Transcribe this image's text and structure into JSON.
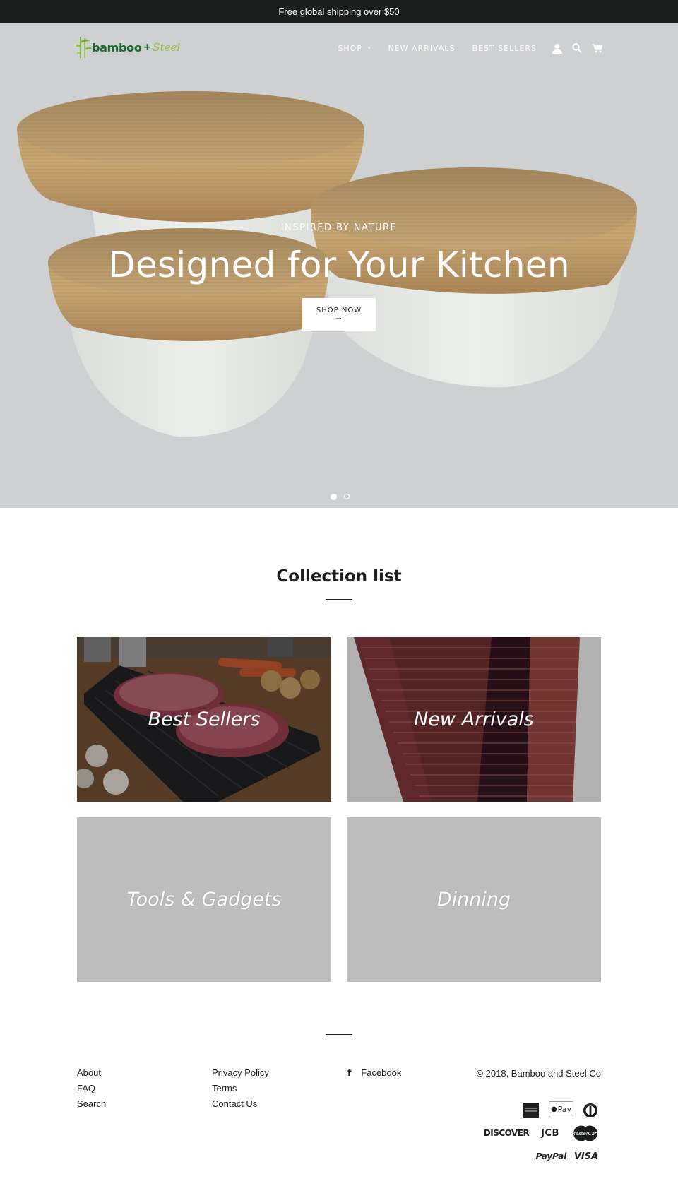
{
  "announcement": {
    "text": "Free global shipping over $50"
  },
  "header": {
    "logo": {
      "word": "bamboo",
      "plus": "+",
      "steel": "Steel"
    },
    "nav": [
      {
        "label": "SHOP",
        "has_dropdown": true
      },
      {
        "label": "NEW ARRIVALS",
        "has_dropdown": false
      },
      {
        "label": "BEST SELLERS",
        "has_dropdown": false
      }
    ],
    "icons": [
      "account-icon",
      "search-icon",
      "cart-icon"
    ],
    "dropdown_caret": "▾"
  },
  "hero": {
    "subheading": "INSPIRED BY NATURE",
    "title": "Designed for Your Kitchen",
    "button_label": "SHOP NOW",
    "button_arrow": "→",
    "slides_total": 2,
    "active_slide": 1
  },
  "collection": {
    "title": "Collection list",
    "items": [
      {
        "label": "Best Sellers"
      },
      {
        "label": "New Arrivals"
      },
      {
        "label": "Tools & Gadgets"
      },
      {
        "label": "Dinning"
      }
    ]
  },
  "footer": {
    "col1": [
      "About",
      "FAQ",
      "Search"
    ],
    "col2": [
      "Privacy Policy",
      "Terms",
      "Contact Us"
    ],
    "social": {
      "icon": "f",
      "label": "Facebook"
    },
    "copyright": "© 2018, Bamboo and Steel Co",
    "payments": {
      "amex": "AMERICAN EXPRESS",
      "apple_pay": "Pay",
      "diners": "diners-club",
      "discover": "DISCOVER",
      "jcb": "JCB",
      "mastercard": "MasterCard",
      "paypal": "PayPal",
      "visa": "VISA"
    }
  },
  "colors": {
    "announcement_bg": "#1c1d1d",
    "hero_bg": "#cfd0d2",
    "tile_placeholder": "#bebebe",
    "logo_green": "#1a6b2a",
    "logo_lime": "#8fc13a"
  }
}
